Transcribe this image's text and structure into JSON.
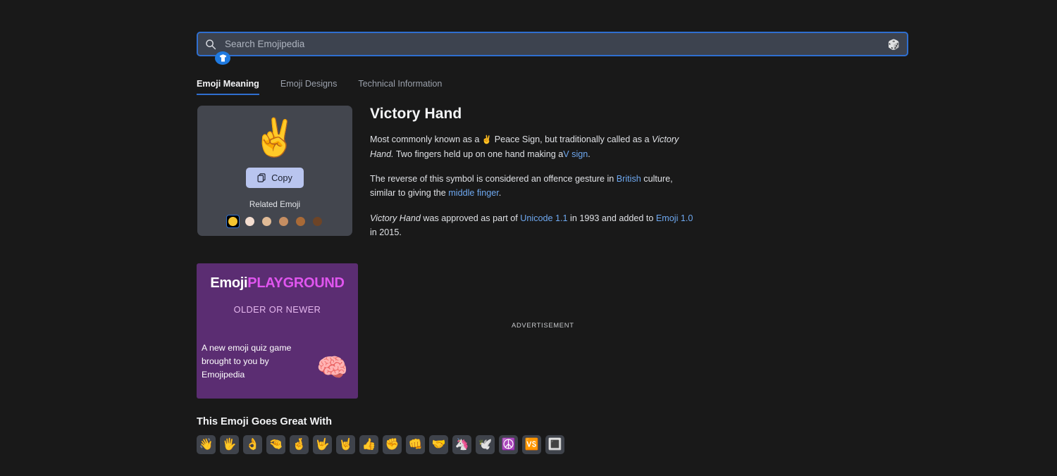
{
  "search": {
    "placeholder": "Search Emojipedia",
    "value": "",
    "search_icon": "search-icon",
    "random_icon": "🎲",
    "badge_icon": "shirt-badge-icon"
  },
  "tabs": [
    {
      "label": "Emoji Meaning",
      "active": true
    },
    {
      "label": "Emoji Designs",
      "active": false
    },
    {
      "label": "Technical Information",
      "active": false
    }
  ],
  "emoji_card": {
    "glyph": "✌️",
    "copy_label": "Copy",
    "copy_icon": "copy-icon",
    "related_label": "Related Emoji",
    "tones": [
      {
        "name": "default-yellow",
        "color": "#f4c430",
        "selected": true
      },
      {
        "name": "light-skin-tone",
        "color": "#f3ddd0",
        "selected": false
      },
      {
        "name": "medium-light-skin-tone",
        "color": "#e0bb97",
        "selected": false
      },
      {
        "name": "medium-skin-tone",
        "color": "#c68e62",
        "selected": false
      },
      {
        "name": "medium-dark-skin-tone",
        "color": "#a96a37",
        "selected": false
      },
      {
        "name": "dark-skin-tone",
        "color": "#6d4427",
        "selected": false
      }
    ]
  },
  "article": {
    "title": "Victory Hand",
    "p1": {
      "a": "Most commonly known as a",
      "emoji": "✌️",
      "b": "Peace Sign, but traditionally called as a",
      "em1": "Victory Hand.",
      "c": "Two fingers held up on one hand making a",
      "link1": "V sign",
      "d": "."
    },
    "p2": {
      "a": "The reverse of this symbol is considered an offence gesture in",
      "link1": "British",
      "b": "culture, similar to giving the",
      "link2": "middle finger",
      "c": "."
    },
    "p3": {
      "em1": "Victory Hand",
      "a": "was approved as part of",
      "link1": "Unicode 1.1",
      "b": "in 1993 and added to",
      "link2": "Emoji 1.0",
      "c": "in 2015."
    }
  },
  "ad_banner": {
    "logo_part1": "Emoji",
    "logo_part2": "PLAYGROUND",
    "subtitle": "OLDER OR NEWER",
    "body": "A new emoji quiz game brought to you by Emojipedia",
    "art_emoji": "🧠"
  },
  "advertisement": {
    "label": "ADVERTISEMENT"
  },
  "goes_great_with": {
    "title": "This Emoji Goes Great With",
    "items": [
      {
        "name": "waving-hand",
        "glyph": "👋"
      },
      {
        "name": "hand-with-fingers-splayed",
        "glyph": "🖐️"
      },
      {
        "name": "ok-hand",
        "glyph": "👌"
      },
      {
        "name": "pinching-hand",
        "glyph": "🤏"
      },
      {
        "name": "crossed-fingers",
        "glyph": "🤞"
      },
      {
        "name": "love-you-gesture",
        "glyph": "🤟"
      },
      {
        "name": "sign-of-the-horns",
        "glyph": "🤘"
      },
      {
        "name": "thumbs-up",
        "glyph": "👍"
      },
      {
        "name": "raised-fist",
        "glyph": "✊"
      },
      {
        "name": "oncoming-fist",
        "glyph": "👊"
      },
      {
        "name": "handshake",
        "glyph": "🤝"
      },
      {
        "name": "unicorn",
        "glyph": "🦄"
      },
      {
        "name": "dove",
        "glyph": "🕊️"
      },
      {
        "name": "peace-symbol",
        "glyph": "☮️"
      },
      {
        "name": "vs-button",
        "glyph": "🆚"
      },
      {
        "name": "white-square-button",
        "glyph": "🔳"
      }
    ]
  },
  "colors": {
    "page_bg": "#191919",
    "card_bg": "#43464e",
    "search_bg": "#3d434f",
    "accent_blue": "#2f6fd0",
    "link_blue": "#6ea8f0",
    "ad_purple": "#5b2d72",
    "ad_magenta": "#e055ef"
  }
}
